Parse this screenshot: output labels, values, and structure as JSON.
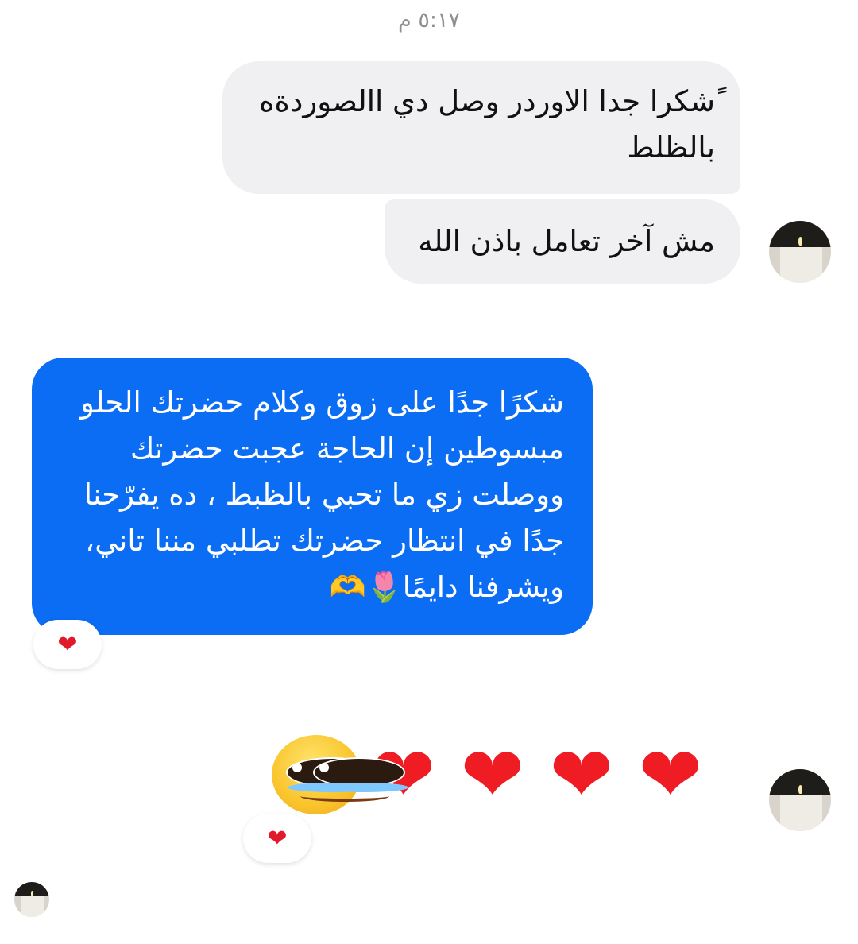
{
  "chat": {
    "timestamp": "٥:١٧ م",
    "messages": [
      {
        "sender": "other",
        "text": "ًشكرا جدا الاوردر وصل دي االصوردةه بالظلط"
      },
      {
        "sender": "other",
        "text": "مش آخر تعامل باذن الله"
      },
      {
        "sender": "self",
        "text": "شكرًا جدًا على زوق وكلام حضرتك الحلو مبسوطين إن الحاجة عجبت حضرتك ووصلت زي ما تحبي بالظبط ، ده يفرّحنا جدًا في انتظار حضرتك تطلبي مننا تاني، ويشرفنا دايمًا🌷🫶"
      }
    ],
    "reactions": [
      {
        "emoji": "❤"
      },
      {
        "emoji": "❤"
      }
    ],
    "emoji_message": {
      "hearts": [
        "❤",
        "❤",
        "❤",
        "❤"
      ],
      "face": "pleading-face"
    }
  },
  "colors": {
    "incoming_bubble": "#f0f0f2",
    "outgoing_bubble": "#0b6cf4",
    "heart": "#ef1c24"
  }
}
